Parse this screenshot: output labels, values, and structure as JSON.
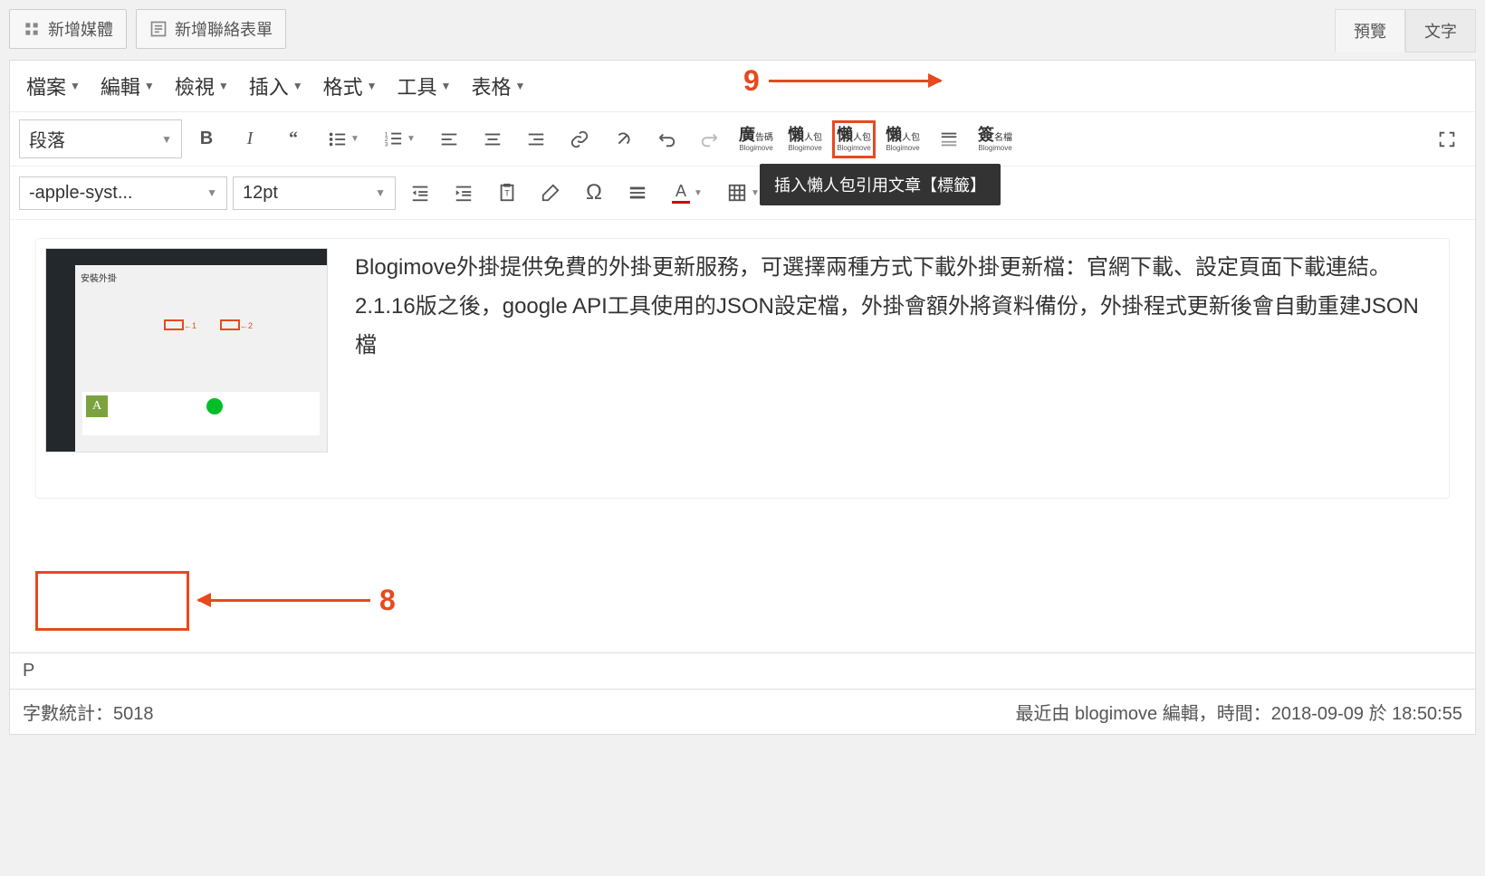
{
  "topButtons": {
    "addMedia": "新增媒體",
    "addContactForm": "新增聯絡表單"
  },
  "tabs": {
    "preview": "預覽",
    "text": "文字"
  },
  "menuBar": {
    "file": "檔案",
    "edit": "編輯",
    "view": "檢視",
    "insert": "插入",
    "format": "格式",
    "tools": "工具",
    "table": "表格"
  },
  "toolbar": {
    "formatSelect": "段落",
    "fontFamily": "-apple-syst...",
    "fontSize": "12pt"
  },
  "customButtons": {
    "ad": {
      "main": "廣",
      "sub": "告碼",
      "brand": "Blogimove"
    },
    "lazy1": {
      "main": "懶",
      "sub": "人包",
      "brand": "Blogimove"
    },
    "lazy2": {
      "main": "懶",
      "sub": "人包",
      "brand": "Blogimove"
    },
    "lazy3": {
      "main": "懶",
      "sub": "人包",
      "brand": "Blogimove"
    },
    "sign": {
      "main": "簽",
      "sub": "名檔",
      "brand": "Blogimove"
    }
  },
  "tooltip": "插入懶人包引用文章【標籤】",
  "annotations": {
    "num8": "8",
    "num9": "9"
  },
  "content": {
    "thumbTitle": "安裝外掛",
    "arr1": "←1",
    "arr2": "←2",
    "paragraph": "Blogimove外掛提供免費的外掛更新服務，可選擇兩種方式下載外掛更新檔：官網下載、設定頁面下載連結。2.1.16版之後，google API工具使用的JSON設定檔，外掛會額外將資料備份，外掛程式更新後會自動重建JSON檔"
  },
  "statusBar": {
    "path": "P",
    "wordCountLabel": "字數統計：",
    "wordCount": "5018",
    "lastEditLabel": "最近由 blogimove 編輯，時間：",
    "lastEditTime": "2018-09-09 於 18:50:55"
  }
}
